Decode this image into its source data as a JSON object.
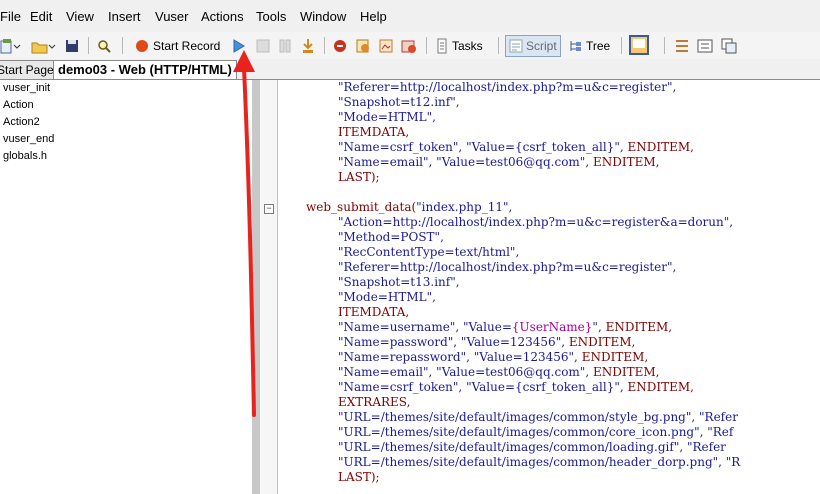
{
  "menu": [
    "File",
    "Edit",
    "View",
    "Insert",
    "Vuser",
    "Actions",
    "Tools",
    "Window",
    "Help"
  ],
  "toolbar": {
    "start_record": "Start Record",
    "tasks": "Tasks",
    "script": "Script",
    "tree": "Tree"
  },
  "tabs": [
    "Start Page",
    "demo03 - Web (HTTP/HTML)"
  ],
  "tree_items": [
    "vuser_init",
    "Action",
    "Action2",
    "vuser_end",
    "globals.h"
  ],
  "code": {
    "l1": "\"Referer=http://localhost/index.php?m=u&c=register\",",
    "l2": "\"Snapshot=t12.inf\",",
    "l3": "\"Mode=HTML\",",
    "l4": "ITEMDATA,",
    "l5a": "\"Name=csrf_token\", \"Value={csrf_token_all}\",",
    "l5b": "ENDITEM,",
    "l6a": "\"Name=email\", \"Value=test06@qq.com\",",
    "l6b": "ENDITEM,",
    "l7": "LAST);",
    "l8a": "web_submit_data(",
    "l8b": "\"index.php_11\",",
    "l9": "\"Action=http://localhost/index.php?m=u&c=register&a=dorun\",",
    "l10": "\"Method=POST\",",
    "l11": "\"RecContentType=text/html\",",
    "l12": "\"Referer=http://localhost/index.php?m=u&c=register\",",
    "l13": "\"Snapshot=t13.inf\",",
    "l14": "\"Mode=HTML\",",
    "l15": "ITEMDATA,",
    "l16a": "\"Name=username\", \"Value=",
    "l16p": "{UserName}",
    "l16c": "\",",
    "l16b": "ENDITEM,",
    "l17a": "\"Name=password\", \"Value=123456\",",
    "l17b": "ENDITEM,",
    "l18a": "\"Name=repassword\", \"Value=123456\",",
    "l18b": "ENDITEM,",
    "l19a": "\"Name=email\", \"Value=test06@qq.com\",",
    "l19b": "ENDITEM,",
    "l20a": "\"Name=csrf_token\", \"Value={csrf_token_all}\",",
    "l20b": "ENDITEM,",
    "l21": "EXTRARES,",
    "l22": "\"URL=/themes/site/default/images/common/style_bg.png\", \"Refer",
    "l23": "\"URL=/themes/site/default/images/common/core_icon.png\", \"Ref",
    "l24": "\"URL=/themes/site/default/images/common/loading.gif\", \"Refer",
    "l25": "\"URL=/themes/site/default/images/common/header_dorp.png\", \"R",
    "l26": "LAST);"
  },
  "colors": {
    "annotation_arrow": "#e8231e",
    "string": "#1a1a96",
    "keyword": "#800000",
    "parameter": "#a000a0"
  }
}
